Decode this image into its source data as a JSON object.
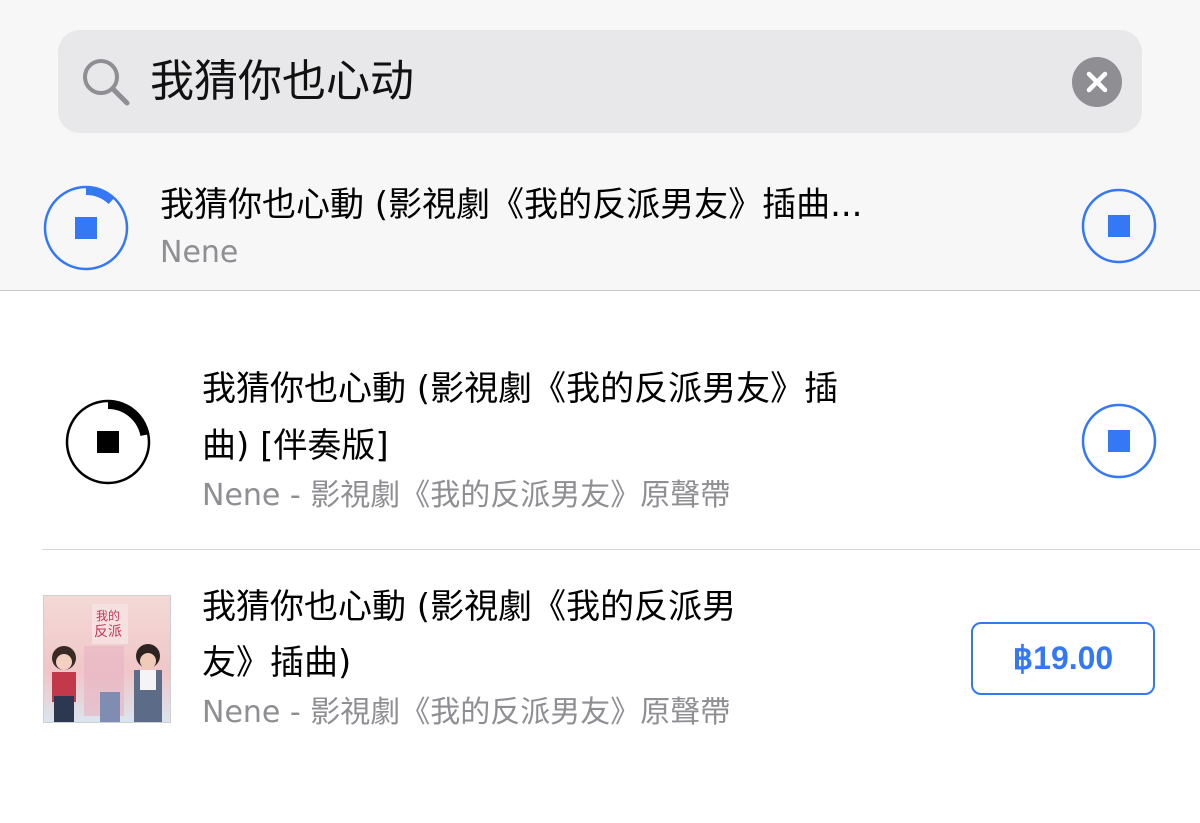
{
  "search": {
    "query": "我猜你也心动"
  },
  "rows": [
    {
      "title": "我猜你也心動 (影視劇《我的反派男友》插曲...",
      "subtitle": "Nene",
      "download_progress": 0.12
    },
    {
      "title_line1": "我猜你也心動 (影視劇《我的反派男友》插",
      "title_line2": "曲) [伴奏版]",
      "subtitle": "Nene - 影視劇《我的反派男友》原聲帶",
      "download_progress": 0.22
    },
    {
      "title_line1": "我猜你也心動 (影視劇《我的反派男",
      "title_line2": "友》插曲)",
      "subtitle": "Nene - 影視劇《我的反派男友》原聲帶",
      "price": "฿19.00"
    }
  ],
  "colors": {
    "accent": "#3478f6",
    "secondary_text": "#8e8e93",
    "search_bg": "#e8e8ea"
  },
  "icons": [
    "search-icon",
    "clear-icon",
    "stop-download-icon",
    "stop-icon"
  ]
}
